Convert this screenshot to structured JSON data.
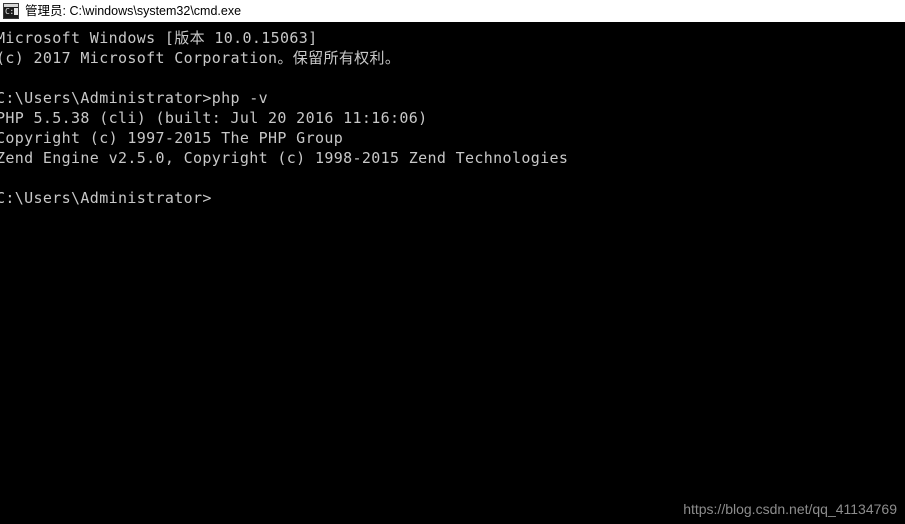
{
  "titlebar": {
    "icon_name": "cmd-exe-icon",
    "icon_prompt_text": "C:\\",
    "title": "管理员: C:\\windows\\system32\\cmd.exe",
    "background_color": "#ffffff",
    "text_color": "#000000"
  },
  "console": {
    "background_color": "#000000",
    "text_color": "#c8c8c8",
    "lines": [
      {
        "text": "Microsoft Windows [版本 10.0.15063]"
      },
      {
        "text": "(c) 2017 Microsoft Corporation。保留所有权利。"
      },
      {
        "text": ""
      },
      {
        "text": "C:\\Users\\Administrator>php -v"
      },
      {
        "text": "PHP 5.5.38 (cli) (built: Jul 20 2016 11:16:06)"
      },
      {
        "text": "Copyright (c) 1997-2015 The PHP Group"
      },
      {
        "text": "Zend Engine v2.5.0, Copyright (c) 1998-2015 Zend Technologies"
      },
      {
        "text": ""
      },
      {
        "text": "C:\\Users\\Administrator>"
      }
    ]
  },
  "watermark": {
    "text": "https://blog.csdn.net/qq_41134769",
    "color": "#8d8d8d"
  }
}
